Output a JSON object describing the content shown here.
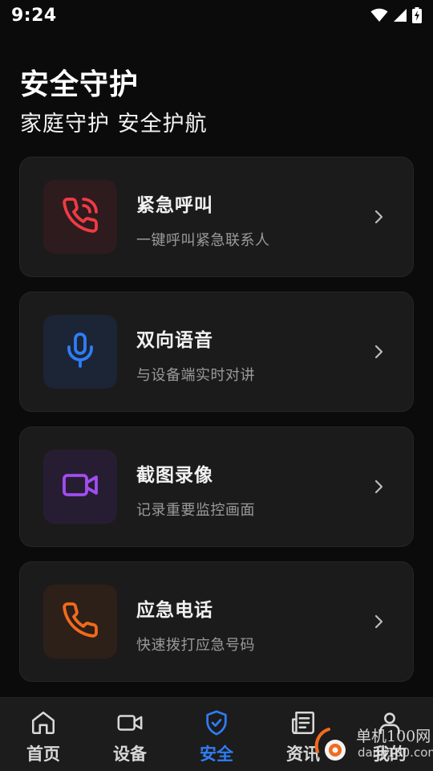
{
  "status_bar": {
    "time": "9:24",
    "icons": [
      "wifi-icon",
      "signal-icon",
      "battery-charging-icon"
    ]
  },
  "header": {
    "title": "安全守护",
    "subtitle": "家庭守护 安全护航"
  },
  "cards": [
    {
      "title": "紧急呼叫",
      "desc": "一键呼叫紧急联系人",
      "icon": "phone-ringing-icon",
      "accent": "#ef3b45",
      "icon_bg": "#2e1b1d"
    },
    {
      "title": "双向语音",
      "desc": "与设备端实时对讲",
      "icon": "microphone-icon",
      "accent": "#2f7df6",
      "icon_bg": "#1b2535"
    },
    {
      "title": "截图录像",
      "desc": "记录重要监控画面",
      "icon": "video-camera-icon",
      "accent": "#a24df0",
      "icon_bg": "#271d33"
    },
    {
      "title": "应急电话",
      "desc": "快速拨打应急号码",
      "icon": "phone-icon",
      "accent": "#f26a1c",
      "icon_bg": "#2d2018"
    }
  ],
  "bottom_nav": {
    "active_index": 2,
    "active_color": "#2f7df6",
    "items": [
      {
        "label": "首页",
        "icon": "home-icon"
      },
      {
        "label": "设备",
        "icon": "camera-icon"
      },
      {
        "label": "安全",
        "icon": "shield-check-icon"
      },
      {
        "label": "资讯",
        "icon": "newspaper-icon"
      },
      {
        "label": "我的",
        "icon": "user-icon"
      }
    ]
  },
  "watermark": {
    "line1": "单机100网",
    "line2": "danji100.com"
  }
}
